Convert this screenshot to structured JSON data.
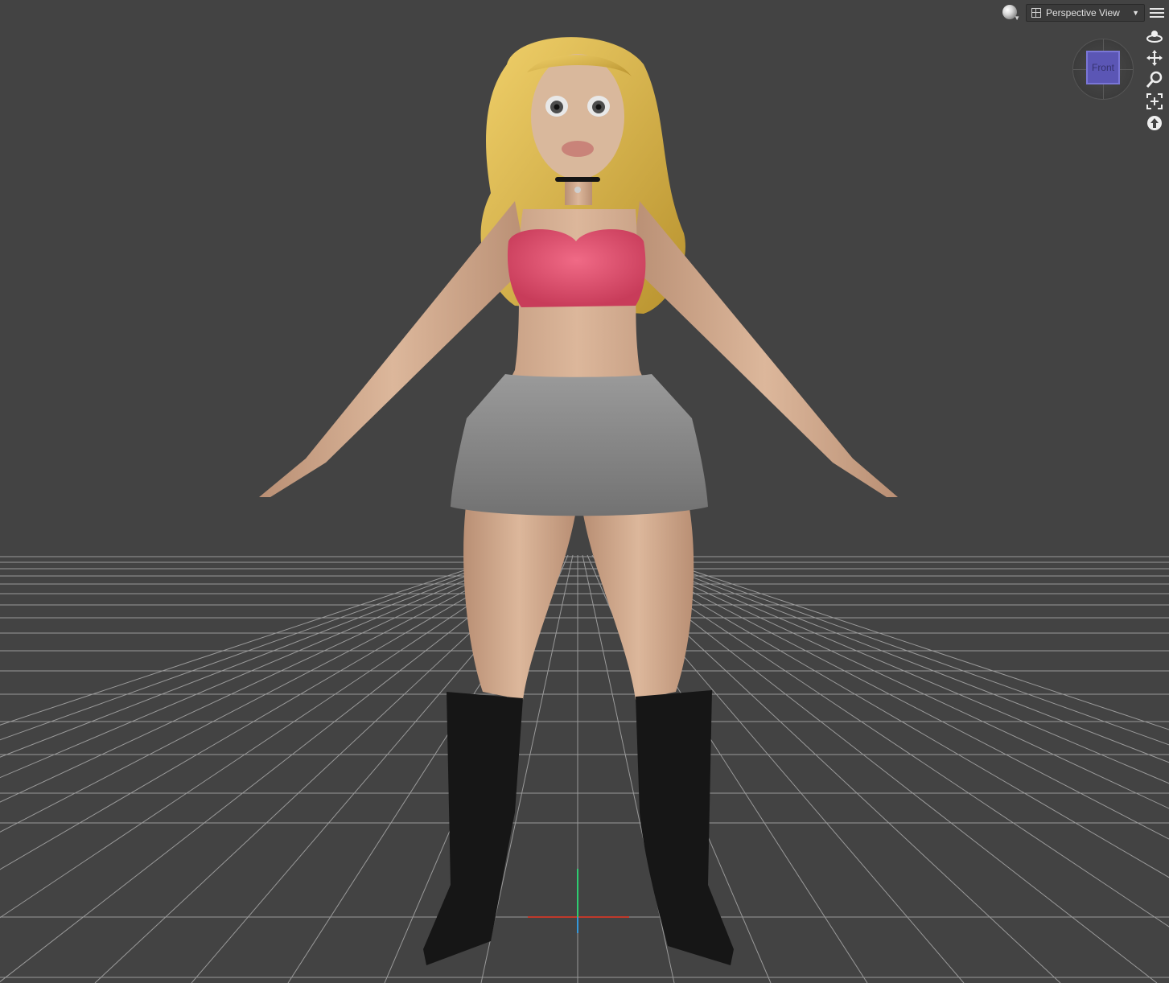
{
  "viewport": {
    "view_name": "Perspective View",
    "cube_face_label": "Front",
    "background_color": "#434343",
    "grid_color": "#9a9a9a",
    "axis_colors": {
      "x": "#c0392b",
      "y": "#2ecc71",
      "z": "#3498db"
    }
  },
  "toolbar": {
    "shading_icon": "sphere-shading-icon",
    "view_icon": "viewport-layout-icon",
    "menu_icon": "hamburger-menu-icon"
  },
  "nav_tools": [
    {
      "name": "orbit-icon"
    },
    {
      "name": "pan-icon"
    },
    {
      "name": "zoom-icon"
    },
    {
      "name": "frame-icon"
    },
    {
      "name": "reset-view-icon"
    }
  ],
  "figure": {
    "hair_color": "#d9b64a",
    "skin_color": "#d8b194",
    "top_color": "#e0526f",
    "skirt_color": "#8c8c8c",
    "boots_color": "#161616"
  }
}
